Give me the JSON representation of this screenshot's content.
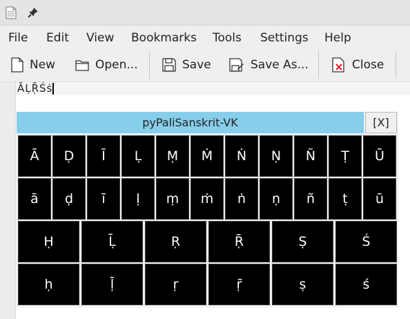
{
  "titlebar": {
    "icons": [
      "document-icon",
      "pin-icon"
    ]
  },
  "menubar": {
    "items": [
      "File",
      "Edit",
      "View",
      "Bookmarks",
      "Tools",
      "Settings",
      "Help"
    ]
  },
  "toolbar": {
    "new_label": "New",
    "open_label": "Open...",
    "save_label": "Save",
    "save_as_label": "Save As...",
    "close_label": "Close"
  },
  "editor": {
    "text": "ĀḶṜŚṡ"
  },
  "keyboard": {
    "title": "pyPaliSanskrit-VK",
    "close_label": "[X]",
    "row1": [
      "Ā",
      "Ḍ",
      "Ī",
      "Ḷ",
      "Ṃ",
      "Ṁ",
      "Ṅ",
      "Ṇ",
      "Ñ",
      "Ṭ",
      "Ū"
    ],
    "row2": [
      "ā",
      "ḍ",
      "ī",
      "ḷ",
      "ṃ",
      "ṁ",
      "ṅ",
      "ṇ",
      "ñ",
      "ṭ",
      "ū"
    ],
    "row3": [
      "Ḥ",
      "Ḹ",
      "Ṛ",
      "Ṝ",
      "Ṣ",
      "Ś"
    ],
    "row4": [
      "ḥ",
      "ḹ",
      "ṛ",
      "ṝ",
      "ṣ",
      "ś"
    ],
    "header_color": "#87ceeb",
    "key_color": "#000000"
  }
}
